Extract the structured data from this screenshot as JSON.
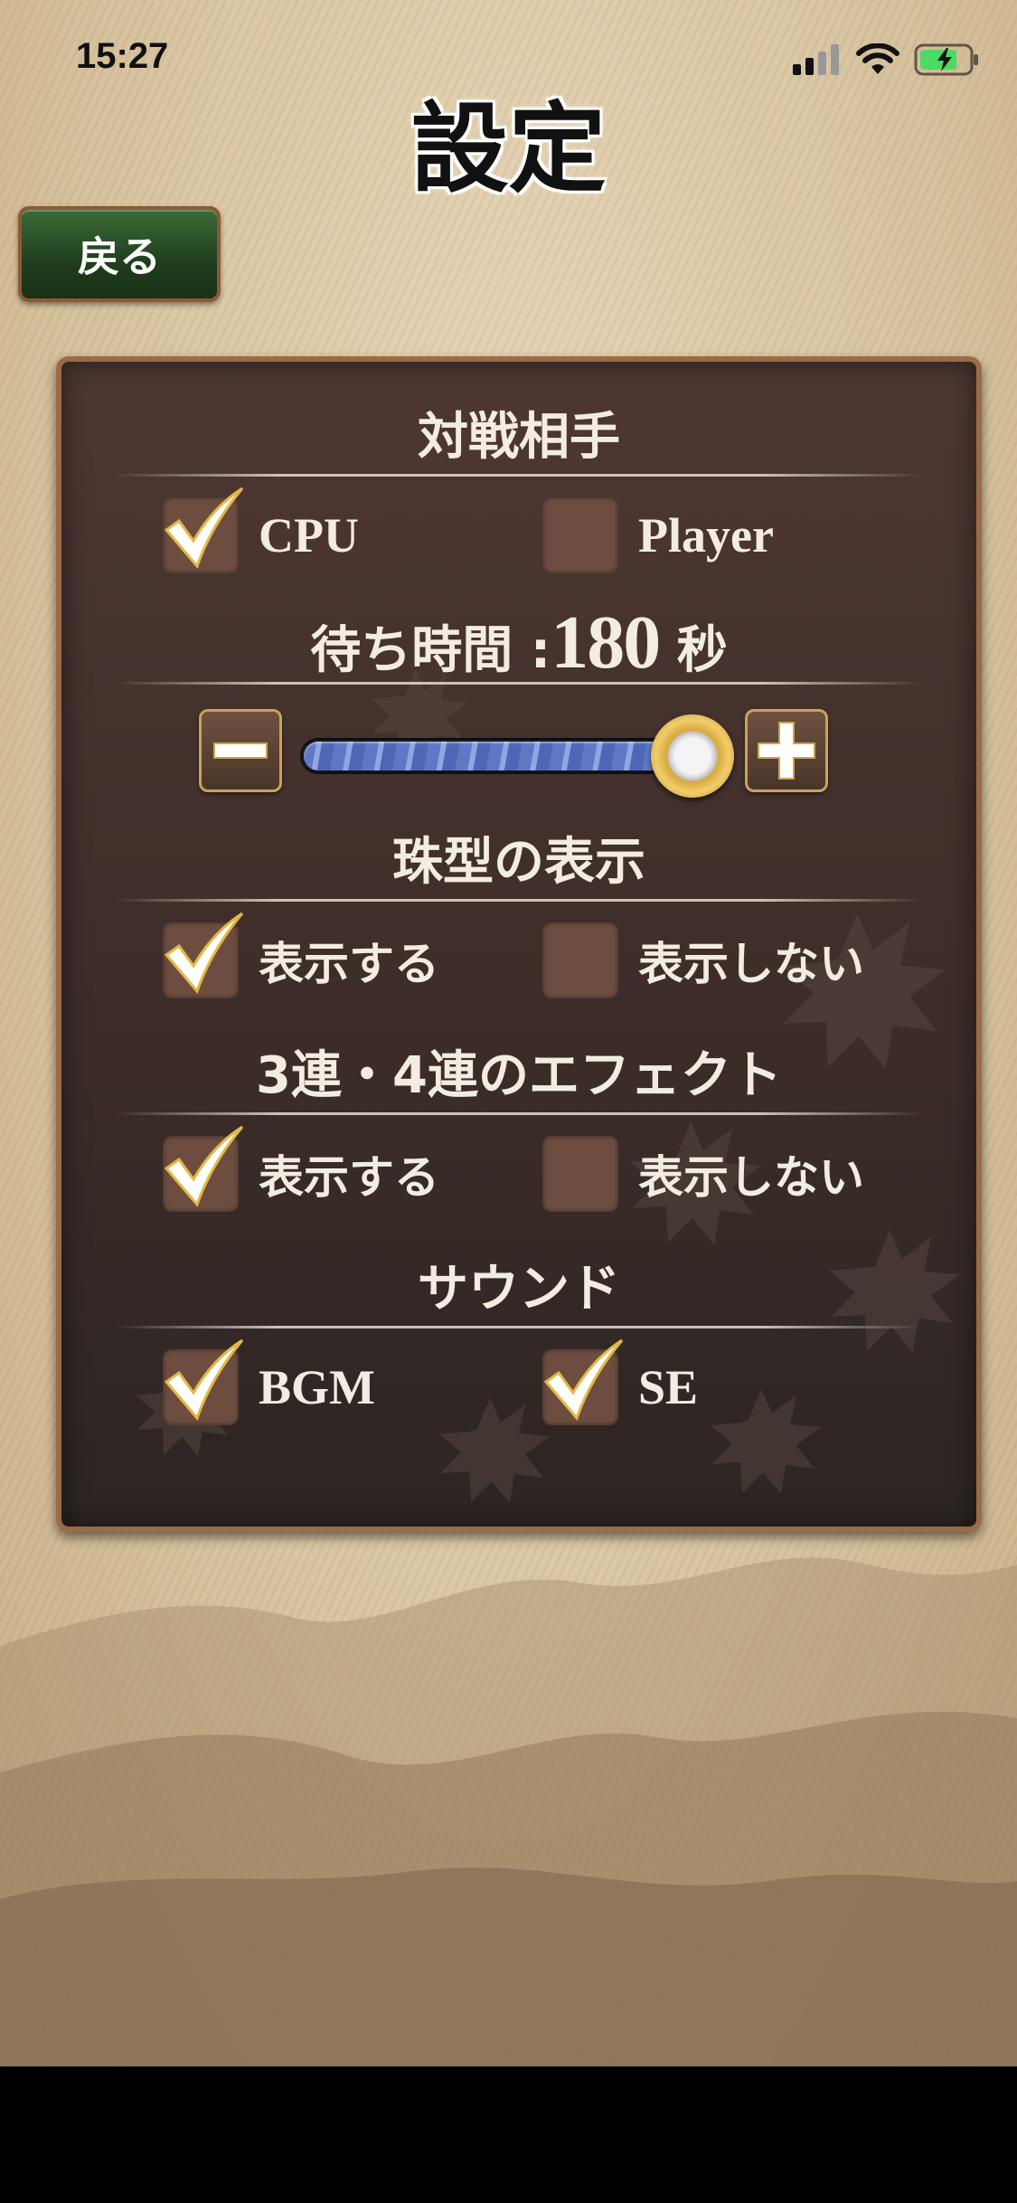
{
  "status_bar": {
    "time": "15:27"
  },
  "title": "設定",
  "back_label": "戻る",
  "opponent": {
    "title": "対戦相手",
    "options": [
      {
        "label": "CPU",
        "checked": true
      },
      {
        "label": "Player",
        "checked": false
      }
    ]
  },
  "wait_time": {
    "label": "待ち時間 :",
    "value": "180",
    "unit": "秒",
    "slider_fraction": 0.93
  },
  "bead_display": {
    "title": "珠型の表示",
    "options": [
      {
        "label": "表示する",
        "checked": true
      },
      {
        "label": "表示しない",
        "checked": false
      }
    ]
  },
  "chain_effect": {
    "title": "3連・4連のエフェクト",
    "options": [
      {
        "label": "表示する",
        "checked": true
      },
      {
        "label": "表示しない",
        "checked": false
      }
    ]
  },
  "sound": {
    "title": "サウンド",
    "options": [
      {
        "label": "BGM",
        "checked": true
      },
      {
        "label": "SE",
        "checked": true
      }
    ]
  },
  "colors": {
    "panel": "#3f2e2a",
    "back_button": "#2b5228",
    "accent_gold": "#c9a35a"
  },
  "icons": [
    "signal-icon",
    "wifi-icon",
    "battery-charging-icon",
    "minus-icon",
    "plus-icon",
    "checkmark-icon"
  ]
}
